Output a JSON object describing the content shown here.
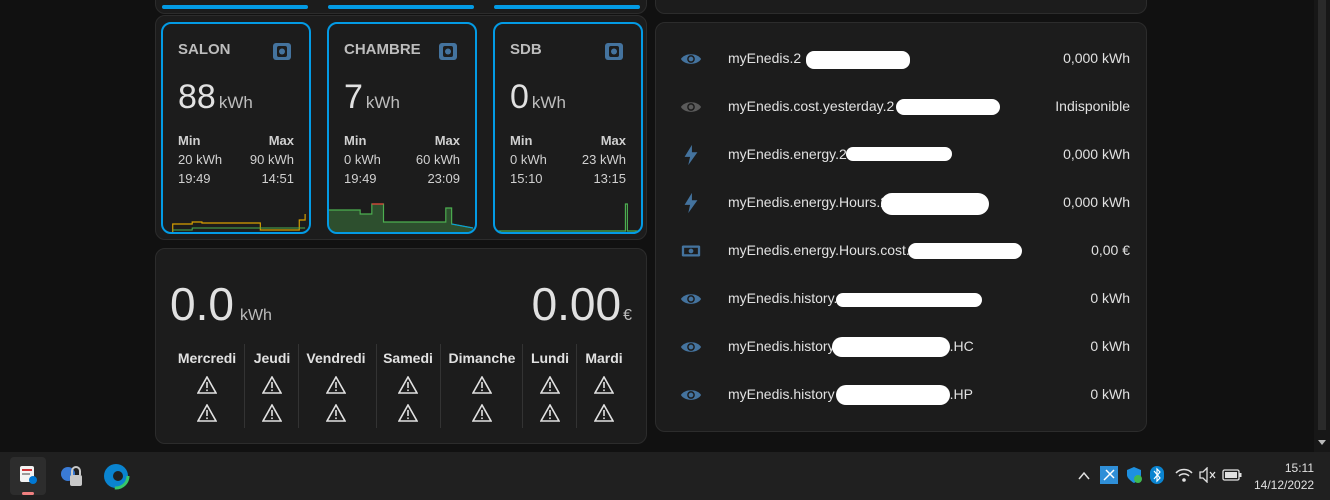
{
  "stat_cards": [
    {
      "title": "SALON",
      "value": "88",
      "unit": "kWh",
      "min_label": "Min",
      "max_label": "Max",
      "min_value": "20 kWh",
      "max_value": "90 kWh",
      "min_time": "19:49",
      "max_time": "14:51",
      "icon": "meter-icon"
    },
    {
      "title": "CHAMBRE",
      "value": "7",
      "unit": "kWh",
      "min_label": "Min",
      "max_label": "Max",
      "min_value": "0 kWh",
      "max_value": "60 kWh",
      "min_time": "19:49",
      "max_time": "23:09",
      "icon": "meter-icon"
    },
    {
      "title": "SDB",
      "value": "0",
      "unit": "kWh",
      "min_label": "Min",
      "max_label": "Max",
      "min_value": "0 kWh",
      "max_value": "23 kWh",
      "min_time": "15:10",
      "max_time": "13:15",
      "icon": "meter-icon"
    }
  ],
  "energy_card": {
    "kwh_value": "0.0",
    "kwh_unit": "kWh",
    "cost_value": "0.00",
    "cost_unit": "€",
    "days": [
      "Mercredi",
      "Jeudi",
      "Vendredi",
      "Samedi",
      "Dimanche",
      "Lundi",
      "Mardi"
    ],
    "warning_icon": "alert-triangle-icon"
  },
  "entities": [
    {
      "name": "myEnedis.2",
      "state": "0,000 kWh",
      "icon": "eye-icon",
      "color": "#44739e"
    },
    {
      "name": "myEnedis.cost.yesterday.2",
      "state": "Indisponible",
      "icon": "eye-icon",
      "color": "#5a5a5a"
    },
    {
      "name": "myEnedis.energy.2",
      "state": "0,000 kWh",
      "icon": "flash-icon",
      "color": "#44739e"
    },
    {
      "name": "myEnedis.energy.Hours.2",
      "state": "0,000 kWh",
      "icon": "flash-icon",
      "color": "#44739e"
    },
    {
      "name": "myEnedis.energy.Hours.cost.",
      "state": "0,00 €",
      "icon": "cash-icon",
      "color": "#44739e"
    },
    {
      "name": "myEnedis.history.",
      "state": "0 kWh",
      "icon": "eye-icon",
      "color": "#44739e"
    },
    {
      "name": "myEnedis.history",
      "name_suffix": ".HC",
      "state": "0 kWh",
      "icon": "eye-icon",
      "color": "#44739e"
    },
    {
      "name": "myEnedis.history",
      "name_suffix": ".HP",
      "state": "0 kWh",
      "icon": "eye-icon",
      "color": "#44739e"
    }
  ],
  "taskbar": {
    "time": "15:11",
    "date": "14/12/2022",
    "apps": [
      "snipping-tool-icon",
      "vpn-lock-icon",
      "edge-browser-icon"
    ],
    "tray": [
      "chevron-up-icon",
      "tray-app-icon",
      "security-shield-icon",
      "bluetooth-icon",
      "wifi-icon",
      "muted-speaker-icon",
      "battery-icon"
    ]
  },
  "colors": {
    "accent": "#039be5",
    "icon_blue": "#44739e",
    "card_bg": "#1c1c1c",
    "page_bg": "#111111"
  }
}
